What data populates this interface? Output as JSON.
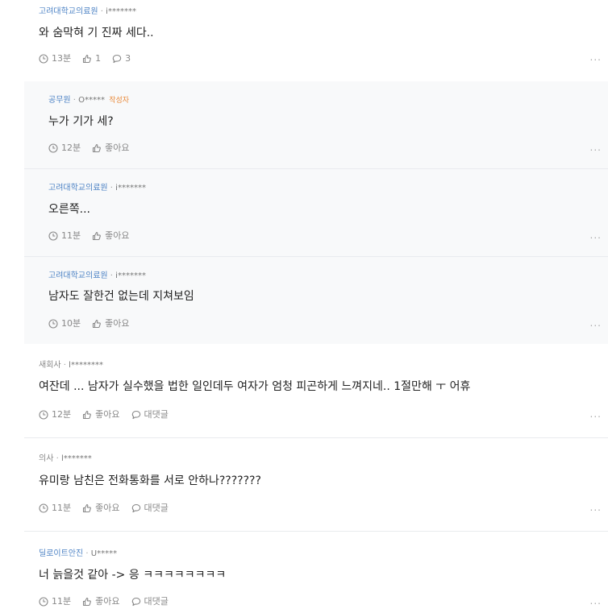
{
  "comments": [
    {
      "company": "고려대학교의료원",
      "sep": "·",
      "user": "i*******",
      "text": "와 숨막혀 기 진짜 세다..",
      "time": "13분",
      "like": "1",
      "reply": "3",
      "more": "..."
    },
    {
      "company": "공무원",
      "sep": "·",
      "user": "O*****",
      "author_tag": "작성자",
      "text": "누가 기가 세?",
      "time": "12분",
      "like": "좋아요",
      "more": "..."
    },
    {
      "company": "고려대학교의료원",
      "sep": "·",
      "user": "i*******",
      "text": "오른쪽...",
      "time": "11분",
      "like": "좋아요",
      "more": "..."
    },
    {
      "company": "고려대학교의료원",
      "sep": "·",
      "user": "i*******",
      "text": "남자도 잘한건 없는데 지쳐보임",
      "time": "10분",
      "like": "좋아요",
      "more": "..."
    },
    {
      "company": "새회사",
      "sep": "·",
      "user": "l********",
      "text": "여잔데 ... 남자가 실수했을 법한 일인데두 여자가 엄청 피곤하게 느껴지네.. 1절만해 ㅜ 어휴",
      "time": "12분",
      "like": "좋아요",
      "reply": "대댓글",
      "more": "..."
    },
    {
      "company": "의사",
      "sep": "·",
      "user": "l*******",
      "text": "유미랑 남친은 전화통화를 서로 안하나???????",
      "time": "11분",
      "like": "좋아요",
      "reply": "대댓글",
      "more": "..."
    },
    {
      "company": "딜로이트안진",
      "sep": "·",
      "user": "U*****",
      "text": "너 늙을것 같아 -> 응 ㅋㅋㅋㅋㅋㅋㅋㅋ",
      "time": "11분",
      "like": "좋아요",
      "reply": "대댓글",
      "more": "..."
    }
  ],
  "icons": {
    "time": "clock-icon",
    "like": "thumbs-up-icon",
    "reply": "speech-bubble-icon"
  },
  "colors": {
    "company_link": "#4d83c5",
    "author_tag": "#e98a3b",
    "reply_bg": "#f8f9fa",
    "meta_gray": "#888888"
  }
}
